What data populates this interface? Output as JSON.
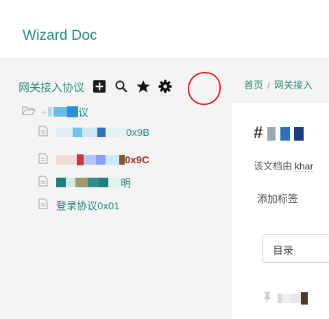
{
  "header": {
    "title": "Wizard Doc"
  },
  "sidebar": {
    "project_title": "网关接入协议",
    "tools": [
      "new-doc-icon",
      "search-icon",
      "star-icon",
      "gear-icon"
    ],
    "tree": {
      "root_suffix": "议",
      "items": [
        {
          "suffix": "0x9B"
        },
        {
          "suffix": "0x9C"
        },
        {
          "suffix": "明"
        },
        {
          "label": "登录协议0x01"
        }
      ]
    }
  },
  "main": {
    "breadcrumb": [
      "首页",
      "网关接入"
    ],
    "title_prefix": "#",
    "author_prefix": "该文档由",
    "author_name": "khar",
    "add_tag": "添加标签",
    "toc_label": "目录"
  },
  "colors": {
    "accent": "#2a8a7e",
    "annotation": "#d82020"
  }
}
